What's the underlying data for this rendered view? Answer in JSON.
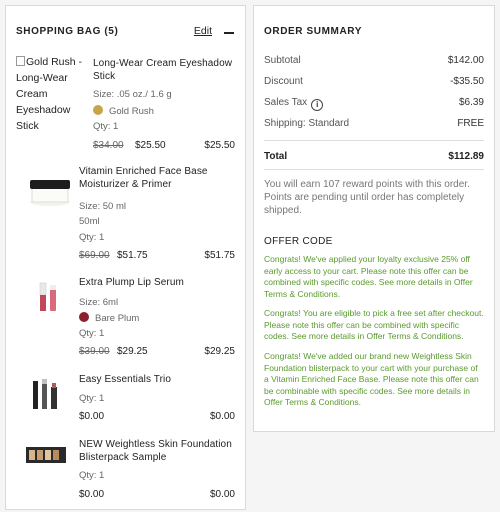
{
  "bag": {
    "title": "SHOPPING BAG (5)",
    "edit_label": "Edit",
    "items": [
      {
        "name": "Long-Wear Cream Eyeshadow Stick",
        "image_alt": "Gold Rush - Long-Wear Cream Eyeshadow Stick",
        "lines": [
          "Size: .05 oz./ 1.6 g"
        ],
        "shade": "Gold Rush",
        "shade_color": "#c9a54a",
        "qty": "Qty: 1",
        "orig_price": "$34.00",
        "sale_price": "$25.50",
        "total": "$25.50"
      },
      {
        "name": "Vitamin Enriched Face Base Moisturizer & Primer",
        "lines": [
          "Size: 50 ml",
          "50ml"
        ],
        "qty": "Qty: 1",
        "orig_price": "$69.00",
        "sale_price": "$51.75",
        "total": "$51.75"
      },
      {
        "name": "Extra Plump Lip Serum",
        "lines": [
          "Size: 6ml"
        ],
        "shade": "Bare Plum",
        "shade_color": "#8a1f2f",
        "qty": "Qty: 1",
        "orig_price": "$39.00",
        "sale_price": "$29.25",
        "total": "$29.25"
      },
      {
        "name": "Easy Essentials Trio",
        "qty": "Qty: 1",
        "sale_price": "$0.00",
        "total": "$0.00"
      },
      {
        "name": "NEW Weightless Skin Foundation Blisterpack Sample",
        "qty": "Qty: 1",
        "sale_price": "$0.00",
        "total": "$0.00"
      }
    ]
  },
  "summary": {
    "title": "ORDER SUMMARY",
    "rows": [
      {
        "label": "Subtotal",
        "value": "$142.00"
      },
      {
        "label": "Discount",
        "value": "-$35.50"
      },
      {
        "label": "Sales Tax",
        "value": "$6.39"
      },
      {
        "label": "Shipping: Standard",
        "value": "FREE"
      }
    ],
    "total_label": "Total",
    "total_value": "$112.89",
    "reward_text": "You will earn 107 reward points with this order. Points are pending until order has completely shipped.",
    "offer_title": "OFFER CODE",
    "offers": [
      "Congrats! We've applied your loyalty exclusive 25% off early access to your cart. Please note this offer can be combined with specific codes. See more details in Offer Terms & Conditions.",
      "Congrats! You are eligible to pick a free set after checkout. Please note this offer can be combined with specific codes. See more details in Offer Terms & Conditions.",
      "Congrats! We've added our brand new Weightless Skin Foundation blisterpack to your cart with your purchase of a Vitamin Enriched Face Base. Please note this offer can be combinable with specific codes. See more details in Offer Terms & Conditions."
    ],
    "info_icon_glyph": "i"
  }
}
